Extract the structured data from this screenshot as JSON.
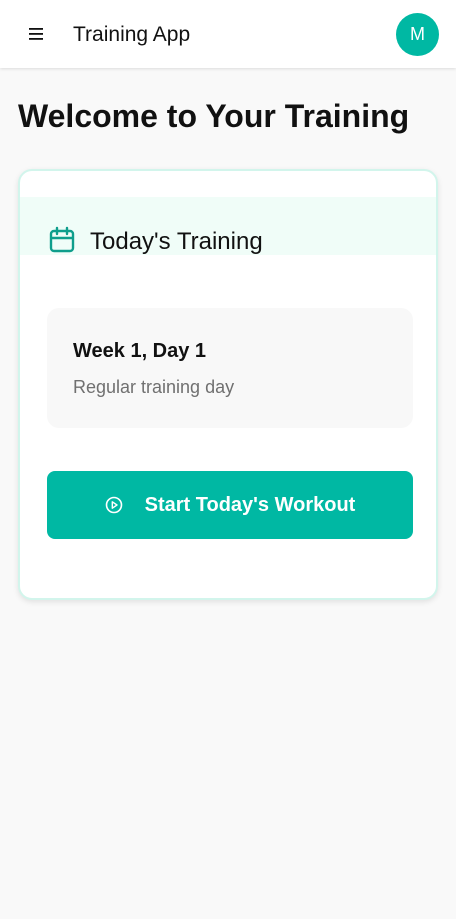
{
  "header": {
    "menu_icon": "hamburger-menu-icon",
    "app_title": "Training App",
    "avatar_initial": "M"
  },
  "main": {
    "heading": "Welcome to Your Training",
    "card": {
      "icon": "calendar-icon",
      "title": "Today's Training",
      "day": {
        "title": "Week 1, Day 1",
        "subtitle": "Regular training day"
      },
      "start_button": {
        "icon": "play-circle-icon",
        "label": "Start Today's Workout"
      }
    }
  },
  "colors": {
    "accent": "#00b8a3",
    "card_header_bg": "#f0fdf8",
    "card_border": "#d2f5ec",
    "page_bg": "#f9f9f9"
  }
}
